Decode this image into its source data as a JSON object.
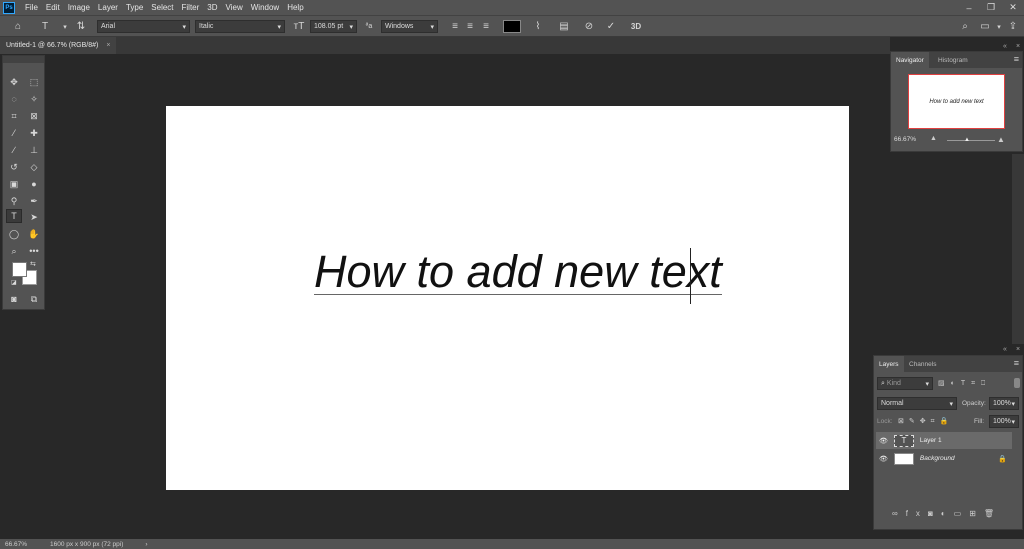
{
  "app": {
    "logo": "Ps"
  },
  "menu": [
    "File",
    "Edit",
    "Image",
    "Layer",
    "Type",
    "Select",
    "Filter",
    "3D",
    "View",
    "Window",
    "Help"
  ],
  "window_controls": {
    "minimize": "–",
    "restore": "❐",
    "close": "✕"
  },
  "options": {
    "font_family": "Arial",
    "font_style": "Italic",
    "font_size": "108.05 pt",
    "antialias": "Windows",
    "text_color": "#000000",
    "three_d": "3D"
  },
  "document": {
    "tab_title": "Untitled-1 @ 66.7% (RGB/8#)",
    "text": "How to add new text"
  },
  "navigator": {
    "tab_active": "Navigator",
    "tab_other": "Histogram",
    "thumb_text": "How to add new text",
    "zoom": "66.67%"
  },
  "layers": {
    "tab_active": "Layers",
    "tab_other": "Channels",
    "kind_placeholder": "Kind",
    "blend_mode": "Normal",
    "opacity_label": "Opacity:",
    "opacity_value": "100%",
    "lock_label": "Lock:",
    "fill_label": "Fill:",
    "fill_value": "100%",
    "items": [
      {
        "name": "Layer 1"
      },
      {
        "name": "Background"
      }
    ]
  },
  "status": {
    "zoom": "66.67%",
    "doc_size": "1600 px x 900 px (72 ppi)"
  },
  "colors": {
    "accent": "#31a8ff",
    "selection": "#e04040"
  }
}
